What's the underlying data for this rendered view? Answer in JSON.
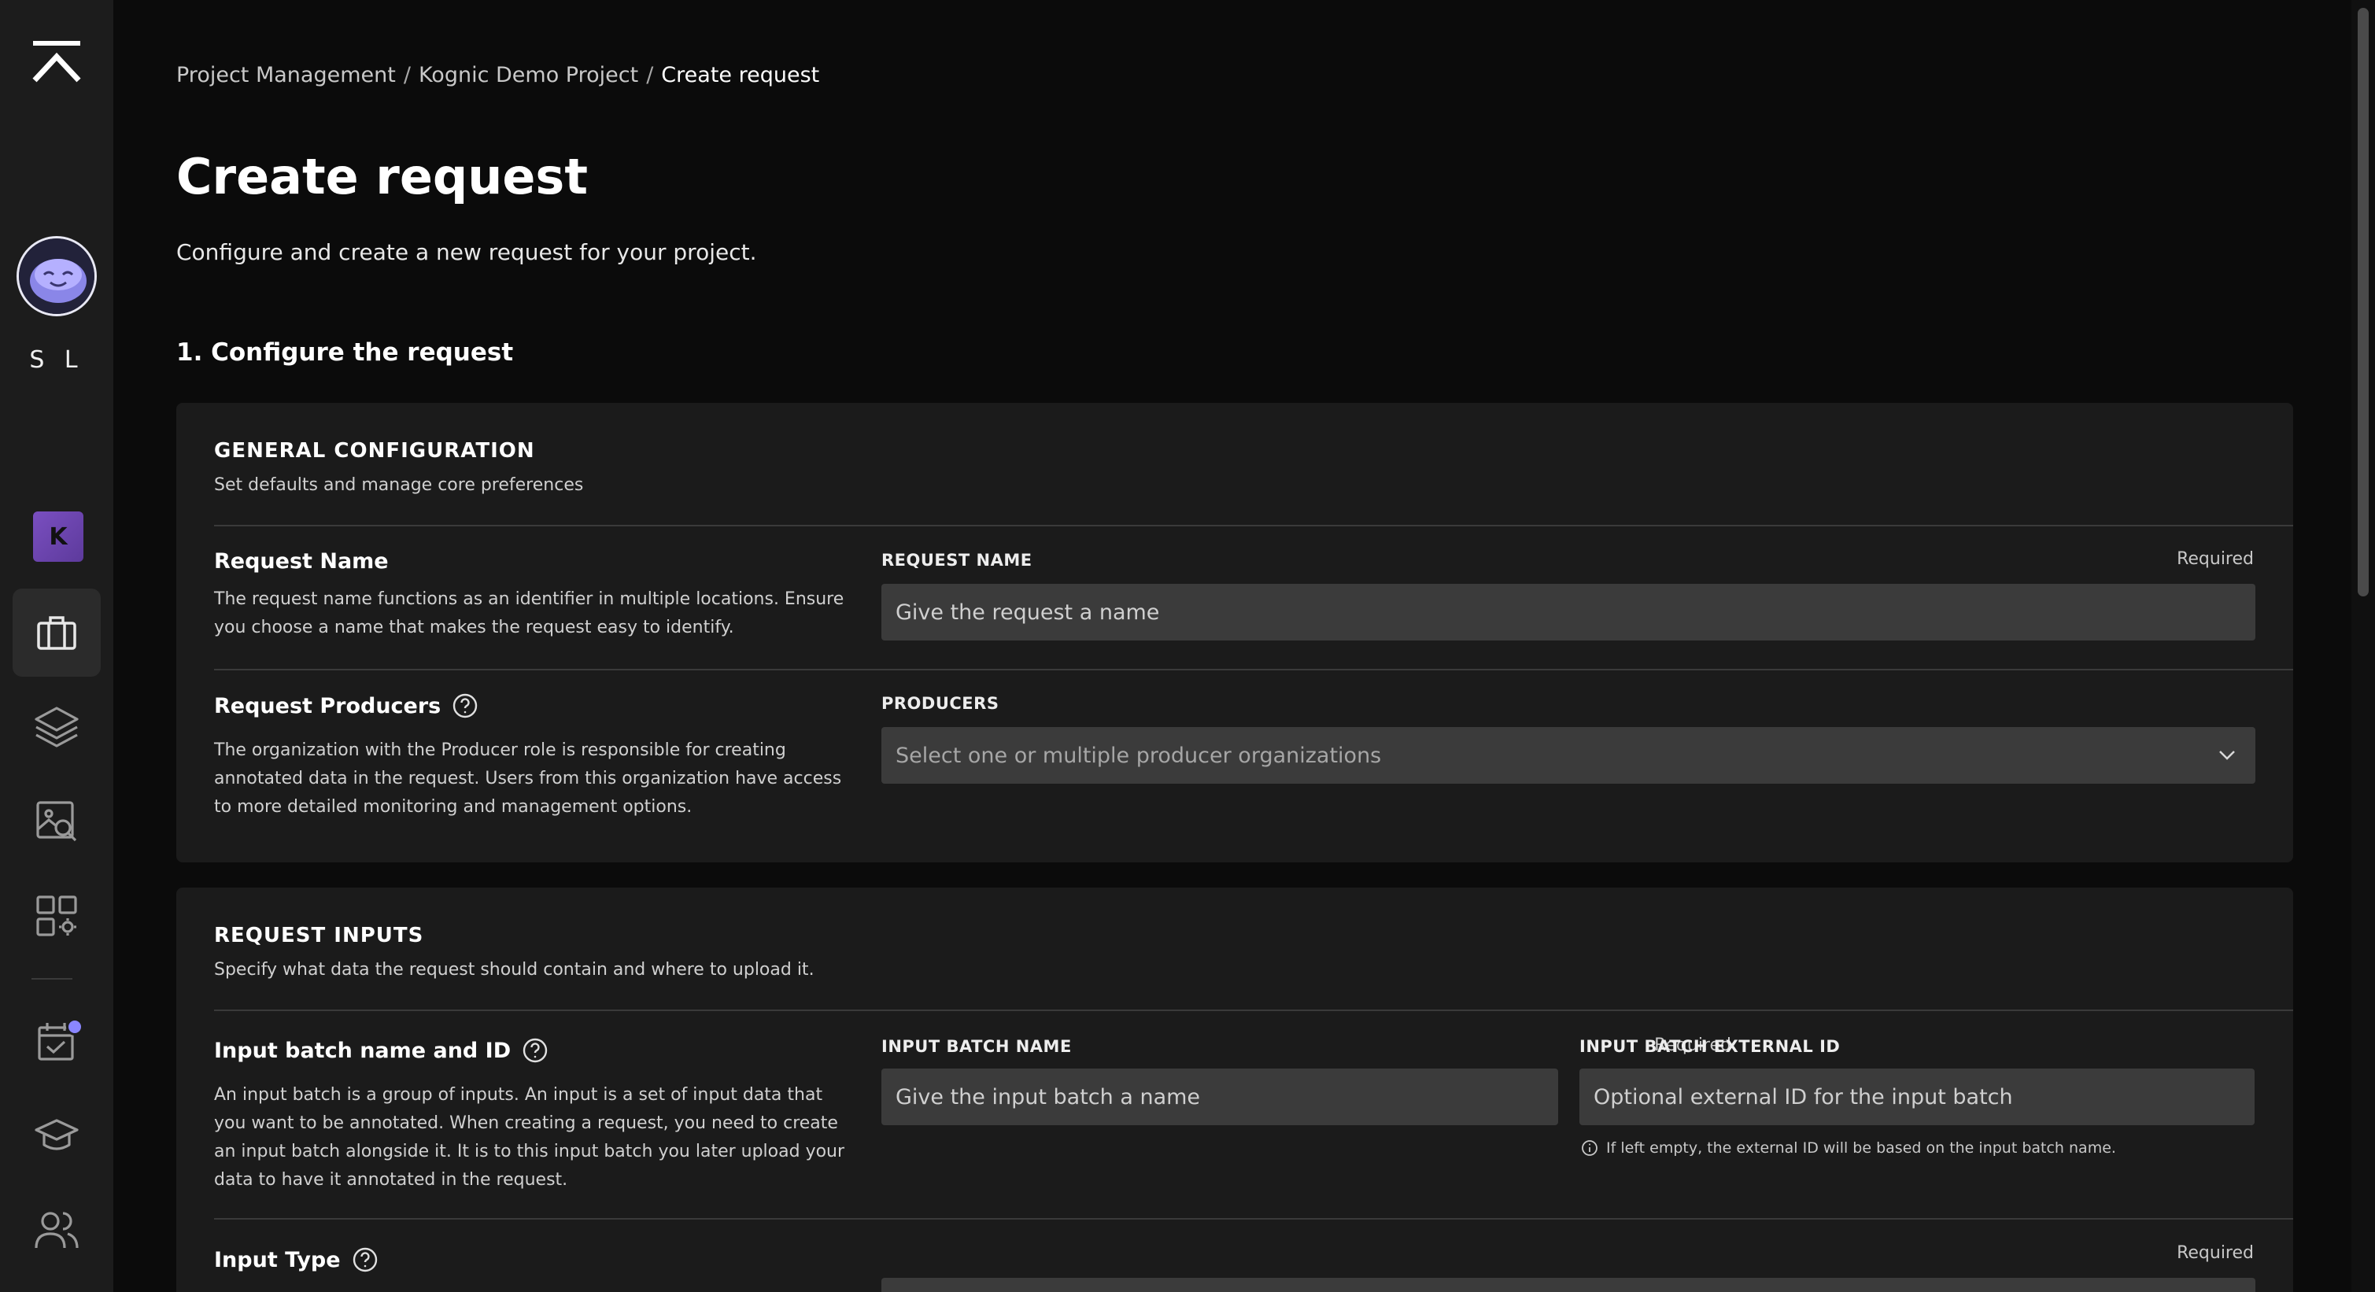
{
  "sidebar": {
    "initials": "S L",
    "org_badge": "K",
    "icons": [
      "kognic-logo-icon",
      "avatar",
      "briefcase-icon",
      "layers-icon",
      "image-search-icon",
      "apps-settings-icon",
      "checklist-icon",
      "graduation-cap-icon",
      "users-icon"
    ]
  },
  "breadcrumb": {
    "items": [
      "Project Management",
      "Kognic Demo Project"
    ],
    "current": "Create request",
    "separator": "/"
  },
  "page": {
    "title": "Create request",
    "subtitle": "Configure and create a new request for your project.",
    "section_title": "1. Configure the request"
  },
  "general": {
    "heading": "GENERAL CONFIGURATION",
    "description": "Set defaults and manage core preferences",
    "request_name": {
      "title": "Request Name",
      "description": "The request name functions as an identifier in multiple locations. Ensure you choose a name that makes the request easy to identify.",
      "label": "REQUEST NAME",
      "required": "Required",
      "placeholder": "Give the request a name"
    },
    "producers": {
      "title": "Request Producers",
      "description": "The organization with the Producer role is responsible for creating annotated data in the request. Users from this organization have access to more detailed monitoring and management options.",
      "label": "PRODUCERS",
      "placeholder": "Select one or multiple producer organizations"
    }
  },
  "inputs": {
    "heading": "REQUEST INPUTS",
    "description": "Specify what data the request should contain and where to upload it.",
    "batch": {
      "title": "Input batch name and ID",
      "description": "An input batch is a group of inputs. An input is a set of input data that you want to be annotated. When creating a request, you need to create an input batch alongside it. It is to this input batch you later upload your data to have it annotated in the request.",
      "name_label": "INPUT BATCH NAME",
      "name_required": "Required",
      "name_placeholder": "Give the input batch a name",
      "external_label": "INPUT BATCH EXTERNAL ID",
      "external_placeholder": "Optional external ID for the input batch",
      "external_hint": "If left empty, the external ID will be based on the input batch name."
    },
    "input_type": {
      "title": "Input Type",
      "required": "Required"
    }
  },
  "colors": {
    "background": "#0b0b0b",
    "sidebar": "#1c1c1c",
    "card": "#1b1b1b",
    "input": "#3b3b3b",
    "accent": "#8a86ff",
    "org_badge": "#6e46b2"
  }
}
